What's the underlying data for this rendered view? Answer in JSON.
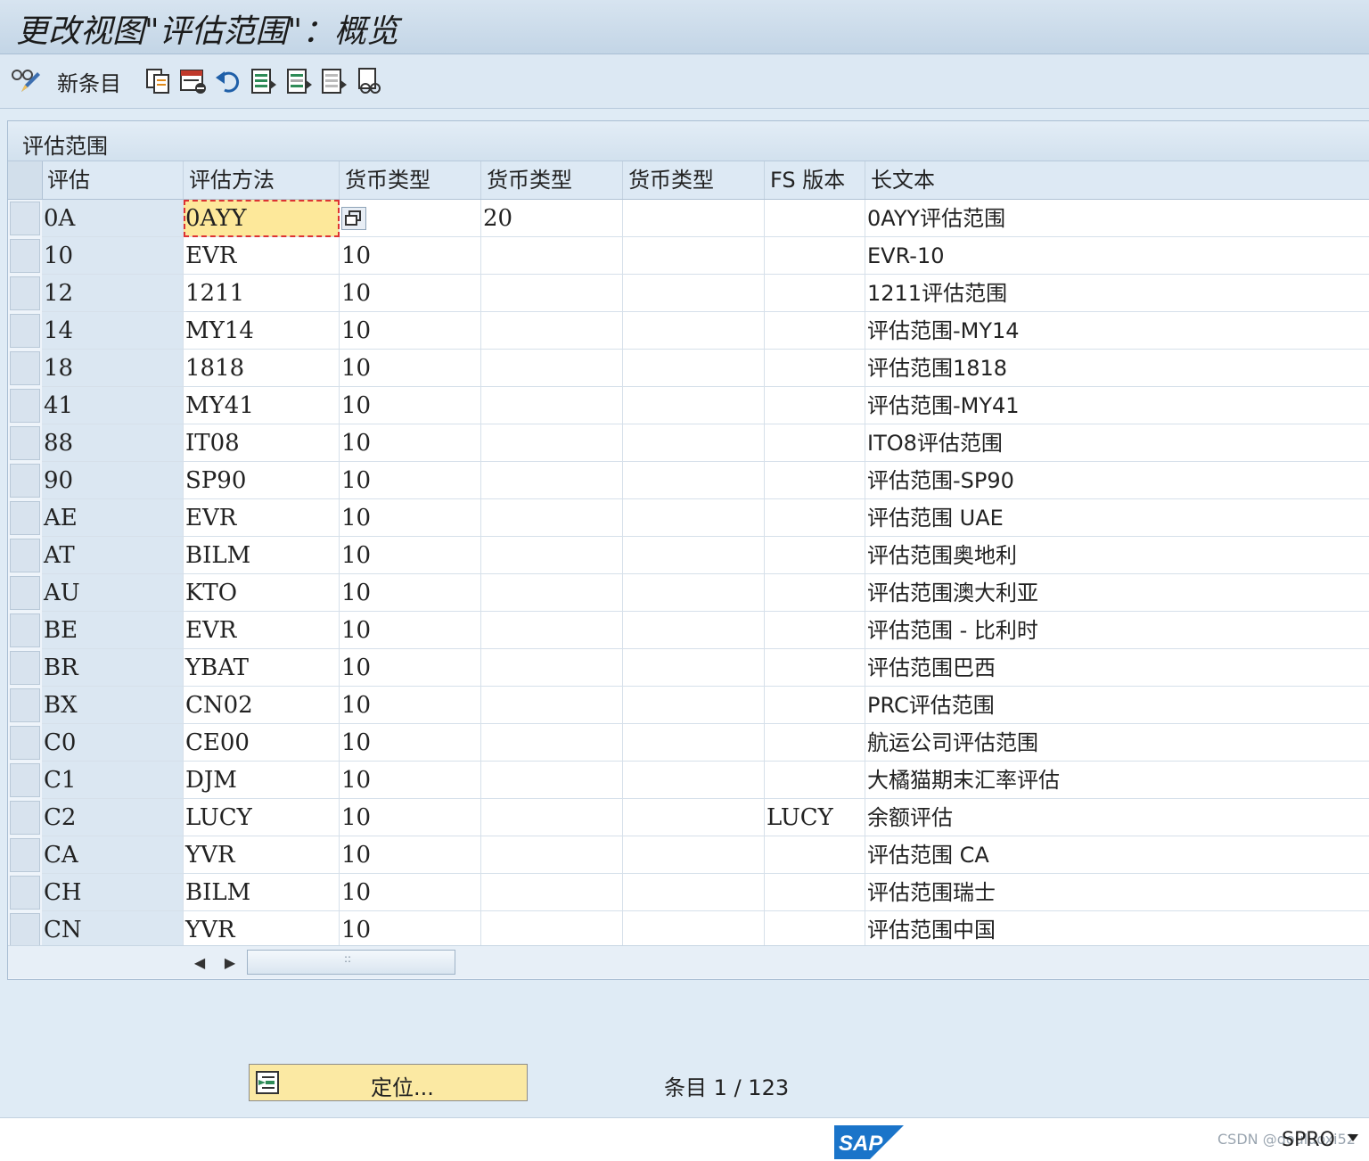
{
  "window": {
    "title": "更改视图\"评估范围\"：概览"
  },
  "toolbar": {
    "display_change_icon": "glasses-pencil-icon",
    "new_entries_label": "新条目",
    "buttons": [
      "copy-icon",
      "delete-icon",
      "undo-icon",
      "select-all-icon",
      "select-block-icon",
      "deselect-all-icon",
      "print-icon"
    ]
  },
  "panel": {
    "title": "评估范围"
  },
  "table": {
    "columns": [
      "评估",
      "评估方法",
      "货币类型",
      "货币类型",
      "货币类型",
      "FS 版本",
      "长文本"
    ],
    "rows": [
      {
        "key": "0A",
        "method": "0AYY",
        "cur1": "",
        "cur2": "20",
        "cur3": "",
        "fs": "",
        "text": "0AYY评估范围"
      },
      {
        "key": "10",
        "method": "EVR",
        "cur1": "10",
        "cur2": "",
        "cur3": "",
        "fs": "",
        "text": "EVR-10"
      },
      {
        "key": "12",
        "method": "1211",
        "cur1": "10",
        "cur2": "",
        "cur3": "",
        "fs": "",
        "text": "1211评估范围"
      },
      {
        "key": "14",
        "method": "MY14",
        "cur1": "10",
        "cur2": "",
        "cur3": "",
        "fs": "",
        "text": "评估范围-MY14"
      },
      {
        "key": "18",
        "method": "1818",
        "cur1": "10",
        "cur2": "",
        "cur3": "",
        "fs": "",
        "text": "评估范围1818"
      },
      {
        "key": "41",
        "method": "MY41",
        "cur1": "10",
        "cur2": "",
        "cur3": "",
        "fs": "",
        "text": "评估范围-MY41"
      },
      {
        "key": "88",
        "method": "IT08",
        "cur1": "10",
        "cur2": "",
        "cur3": "",
        "fs": "",
        "text": "ITO8评估范围"
      },
      {
        "key": "90",
        "method": "SP90",
        "cur1": "10",
        "cur2": "",
        "cur3": "",
        "fs": "",
        "text": "评估范围-SP90"
      },
      {
        "key": "AE",
        "method": "EVR",
        "cur1": "10",
        "cur2": "",
        "cur3": "",
        "fs": "",
        "text": "评估范围 UAE"
      },
      {
        "key": "AT",
        "method": "BILM",
        "cur1": "10",
        "cur2": "",
        "cur3": "",
        "fs": "",
        "text": "评估范围奥地利"
      },
      {
        "key": "AU",
        "method": "KTO",
        "cur1": "10",
        "cur2": "",
        "cur3": "",
        "fs": "",
        "text": "评估范围澳大利亚"
      },
      {
        "key": "BE",
        "method": "EVR",
        "cur1": "10",
        "cur2": "",
        "cur3": "",
        "fs": "",
        "text": "评估范围 - 比利时"
      },
      {
        "key": "BR",
        "method": "YBAT",
        "cur1": "10",
        "cur2": "",
        "cur3": "",
        "fs": "",
        "text": "评估范围巴西"
      },
      {
        "key": "BX",
        "method": "CN02",
        "cur1": "10",
        "cur2": "",
        "cur3": "",
        "fs": "",
        "text": "PRC评估范围"
      },
      {
        "key": "C0",
        "method": "CE00",
        "cur1": "10",
        "cur2": "",
        "cur3": "",
        "fs": "",
        "text": "航运公司评估范围"
      },
      {
        "key": "C1",
        "method": "DJM",
        "cur1": "10",
        "cur2": "",
        "cur3": "",
        "fs": "",
        "text": "大橘猫期末汇率评估"
      },
      {
        "key": "C2",
        "method": "LUCY",
        "cur1": "10",
        "cur2": "",
        "cur3": "",
        "fs": "LUCY",
        "text": "余额评估"
      },
      {
        "key": "CA",
        "method": "YVR",
        "cur1": "10",
        "cur2": "",
        "cur3": "",
        "fs": "",
        "text": "评估范围 CA"
      },
      {
        "key": "CH",
        "method": "BILM",
        "cur1": "10",
        "cur2": "",
        "cur3": "",
        "fs": "",
        "text": "评估范围瑞士"
      },
      {
        "key": "CN",
        "method": "YVR",
        "cur1": "10",
        "cur2": "",
        "cur3": "",
        "fs": "",
        "text": "评估范围中国"
      }
    ]
  },
  "scrollbar": {
    "grip": "::"
  },
  "footer": {
    "position_button_label": "定位...",
    "entry_label": "条目",
    "entry_current": "1",
    "entry_separator": "/",
    "entry_total": "123"
  },
  "status": {
    "logo_text": "SAP",
    "system": "SPRO",
    "watermark": "CSDN @douluoxi52"
  },
  "colors": {
    "accent_edit": "#fde89a",
    "key_column": "#dbe7f2",
    "sap_blue": "#1a74c9"
  }
}
